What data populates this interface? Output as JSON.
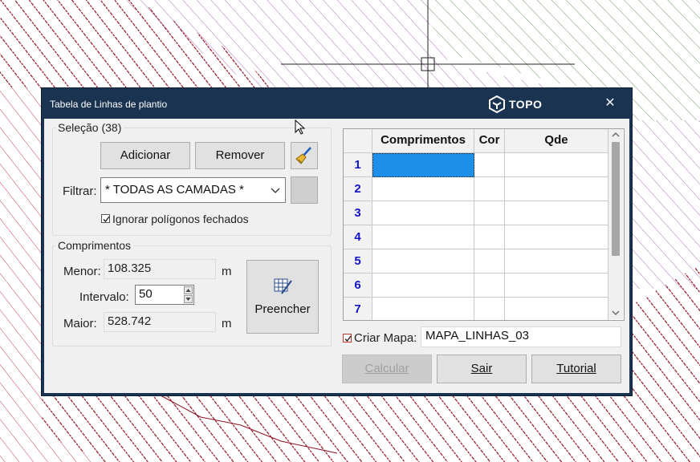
{
  "window": {
    "title": "Tabela de Linhas de plantio",
    "brand": "TOPO",
    "close_glyph": "✕"
  },
  "selecao": {
    "label": "Seleção (38)",
    "add_button": "Adicionar",
    "remove_button": "Remover",
    "filter_label": "Filtrar:",
    "filter_value": "* TODAS AS CAMADAS *",
    "ignore_closed_label": "Ignorar polígonos fechados",
    "ignore_closed_checked": true
  },
  "comprimentos": {
    "label": "Comprimentos",
    "menor_label": "Menor:",
    "menor_value": "108.325",
    "intervalo_label": "Intervalo:",
    "intervalo_value": "50",
    "maior_label": "Maior:",
    "maior_value": "528.742",
    "unit": "m",
    "fill_button": "Preencher"
  },
  "grid": {
    "columns": [
      "Comprimentos",
      "Cor",
      "Qde"
    ],
    "row_numbers": [
      "1",
      "2",
      "3",
      "4",
      "5",
      "6",
      "7"
    ]
  },
  "map": {
    "criar_label": "Criar Mapa:",
    "criar_checked": true,
    "map_name": "MAPA_LINHAS_03"
  },
  "buttons": {
    "calcular": "Calcular",
    "sair": "Sair",
    "tutorial": "Tutorial"
  },
  "icons": [
    "broom-icon",
    "color-swatch",
    "fill-table-icon",
    "topo-logo-icon",
    "close-icon",
    "mouse-cursor-icon",
    "crosshair-icon"
  ],
  "colors": {
    "title_bar": "#1a3350",
    "red_hatch": "#8c1020",
    "green_hatch": "#4a7a36",
    "purple_hatch": "#9a4aa8",
    "row_number": "#1414c8",
    "selected_cell": "#1e8fe6"
  }
}
